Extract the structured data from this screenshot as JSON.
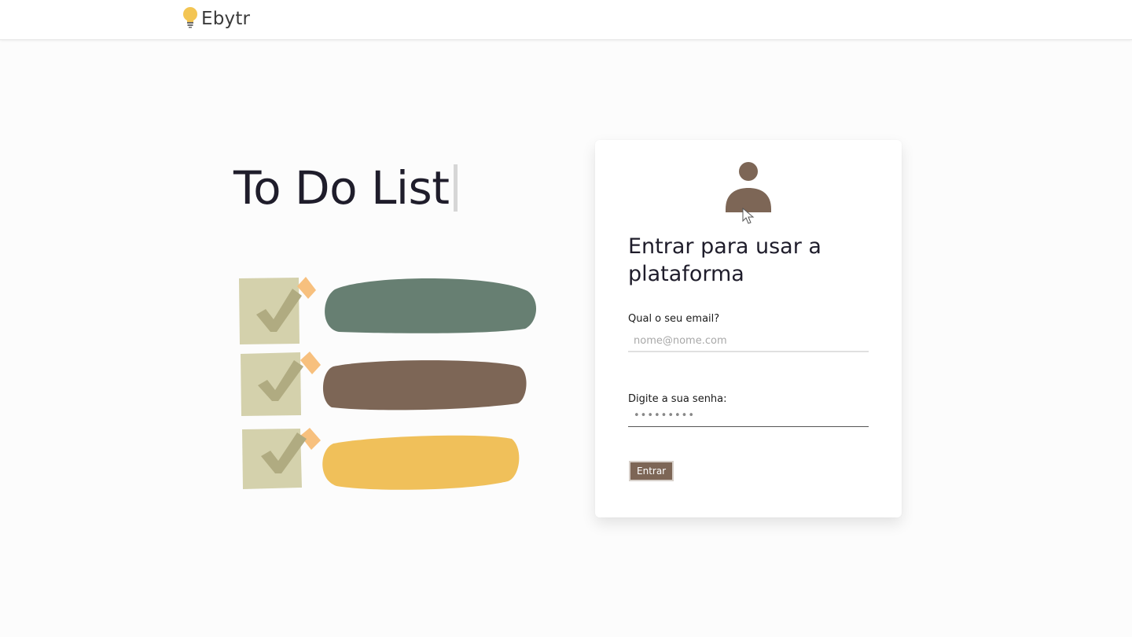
{
  "header": {
    "brand_name": "Ebytr",
    "logo_icon": "lightbulb-icon"
  },
  "hero": {
    "title": "To Do List"
  },
  "illustration": {
    "rows": [
      {
        "check_color": "#b8b386",
        "bar_color": "#677f72"
      },
      {
        "check_color": "#b8b386",
        "bar_color": "#7d6656"
      },
      {
        "check_color": "#b8b386",
        "bar_color": "#f0c05a"
      }
    ],
    "accent_color": "#f7c07e"
  },
  "login": {
    "avatar_icon": "user-avatar-icon",
    "title": "Entrar para usar a plataforma",
    "email_label": "Qual o seu email?",
    "email_placeholder": "nome@nome.com",
    "email_value": "",
    "password_label": "Digite a sua senha:",
    "password_value": "•••••••••",
    "submit_label": "Entrar"
  },
  "colors": {
    "brand_brown": "#7d6656",
    "bulb_yellow": "#f3c553"
  }
}
